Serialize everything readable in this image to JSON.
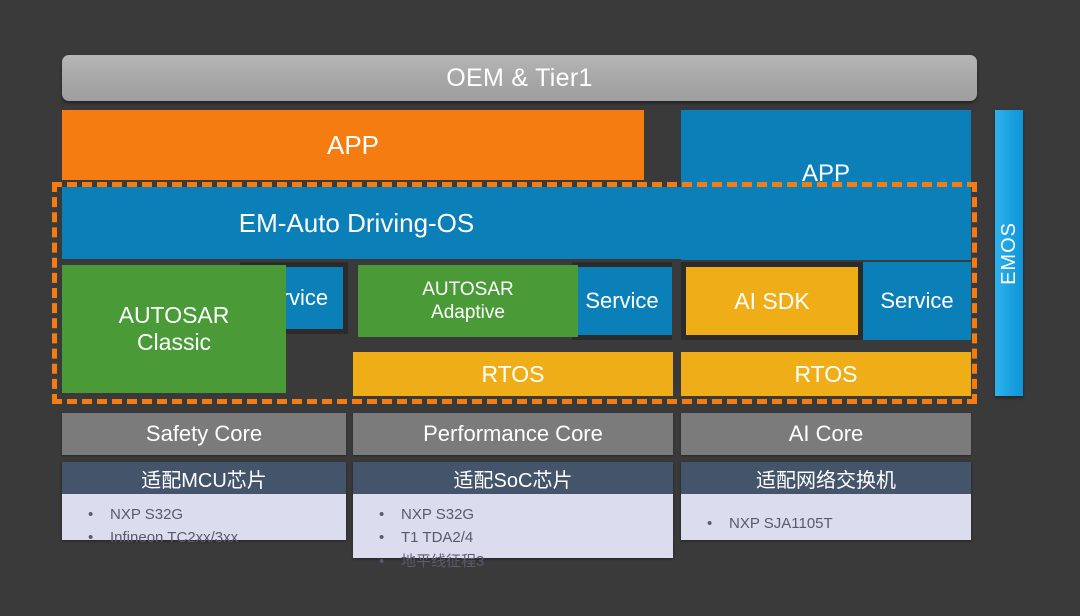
{
  "diagram": {
    "background_color": "#3a3a3a",
    "top_bar": {
      "label": "OEM & Tier1"
    },
    "app_orange": {
      "label": "APP"
    },
    "app_blue": {
      "label": "APP"
    },
    "os_band": {
      "label": "EM-Auto Driving-OS"
    },
    "emos_bar": {
      "label": "EMOS"
    },
    "middleware": {
      "autosar_classic": {
        "line1": "AUTOSAR",
        "line2": "Classic"
      },
      "autosar_adaptive": {
        "line1": "AUTOSAR",
        "line2": "Adaptive"
      },
      "ai_sdk": {
        "label": "AI SDK"
      },
      "service_left": {
        "label": "Service"
      },
      "service_middle": {
        "label": "Service"
      },
      "service_right": {
        "label": "Service"
      },
      "rtos_middle": {
        "label": "RTOS"
      },
      "rtos_right": {
        "label": "RTOS"
      }
    },
    "cores": [
      {
        "label": "Safety Core"
      },
      {
        "label": "Performance Core"
      },
      {
        "label": "AI Core"
      }
    ],
    "chip_cards": [
      {
        "header": "适配MCU芯片",
        "bullet_marker": "•",
        "items": [
          "NXP S32G",
          "Infineon TC2xx/3xx"
        ]
      },
      {
        "header": "适配SoC芯片",
        "bullet_marker": "•",
        "items": [
          "NXP S32G",
          "T1 TDA2/4",
          "地平线征程3"
        ]
      },
      {
        "header": "适配网络交换机",
        "bullet_marker": "•",
        "items": [
          "NXP SJA1105T"
        ]
      }
    ],
    "colors": {
      "orange": "#f57c10",
      "blue": "#0b7fb8",
      "light_blue": "#1ba1e2",
      "green": "#4a9b38",
      "amber": "#efae18",
      "gray": "#7b7b7b",
      "slate": "#44546a",
      "lavender": "#dcdcef"
    }
  }
}
